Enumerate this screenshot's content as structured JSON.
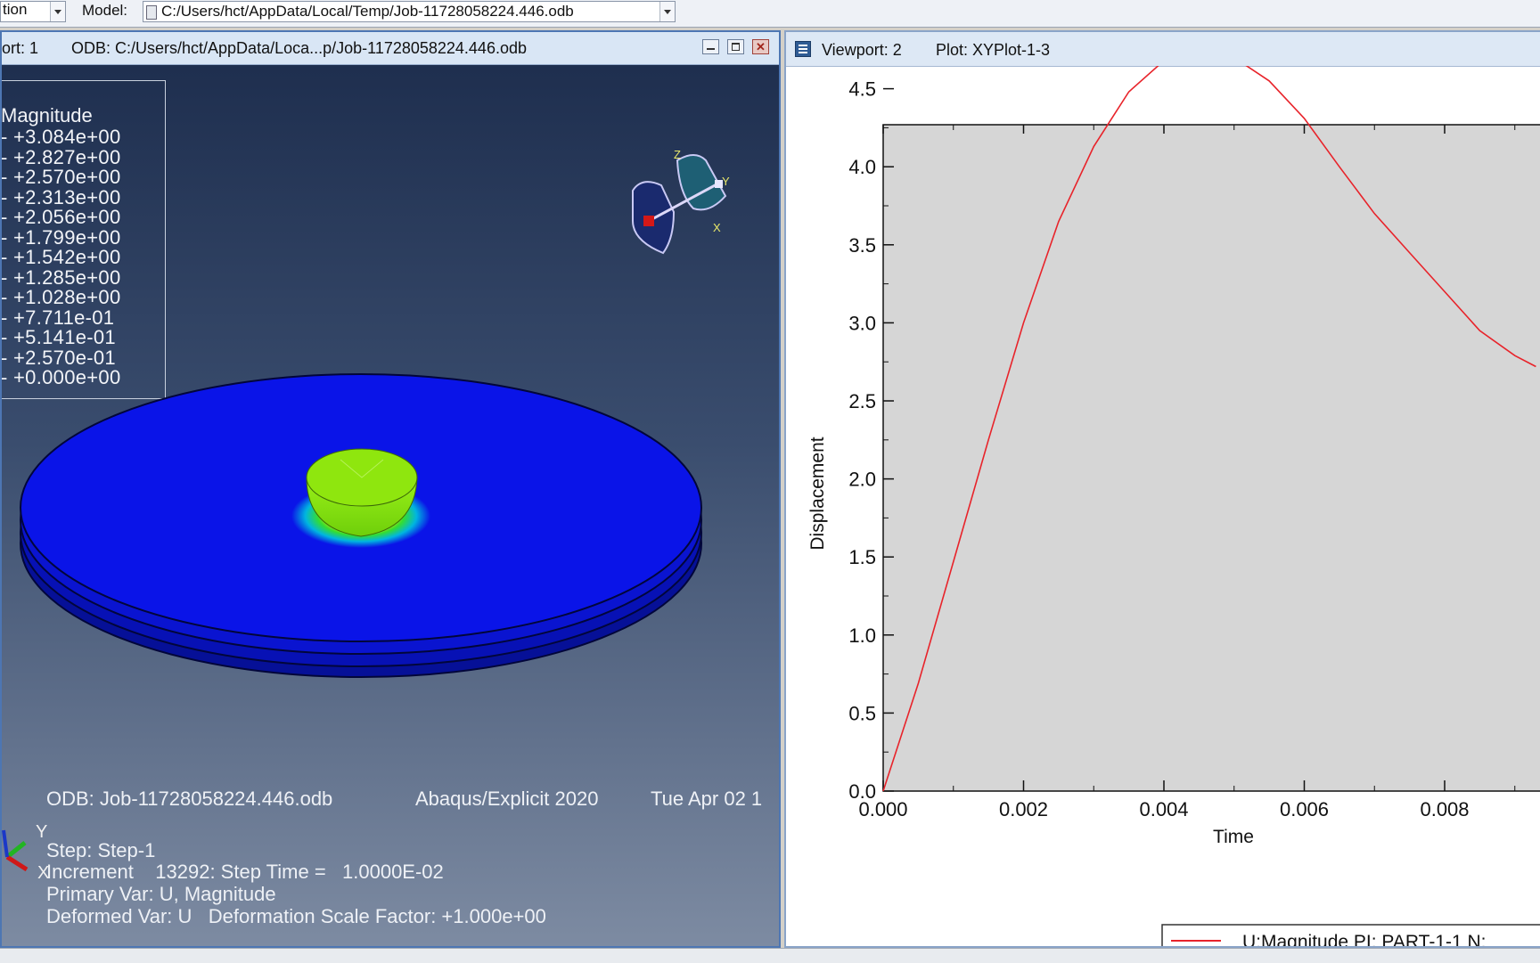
{
  "toolbar": {
    "module_value": "tion",
    "model_label": "Model:",
    "model_path": "C:/Users/hct/AppData/Local/Temp/Job-11728058224.446.odb"
  },
  "viewport1": {
    "title": "ort: 1",
    "odb_path": "ODB: C:/Users/hct/AppData/Loca...p/Job-11728058224.446.odb",
    "legend_title": "Magnitude",
    "legend_values": [
      "+3.084e+00",
      "+2.827e+00",
      "+2.570e+00",
      "+2.313e+00",
      "+2.056e+00",
      "+1.799e+00",
      "+1.542e+00",
      "+1.285e+00",
      "+1.028e+00",
      "+7.711e-01",
      "+5.141e-01",
      "+2.570e-01",
      "+0.000e+00"
    ],
    "triad": {
      "z": "Z",
      "y": "Y",
      "x": "X"
    },
    "info": {
      "odb": "ODB: Job-11728058224.446.odb",
      "solver": "Abaqus/Explicit 2020",
      "date": "Tue Apr 02 1",
      "step": "Step: Step-1",
      "increment": "Increment    13292: Step Time =   1.0000E-02",
      "primary": "Primary Var: U, Magnitude",
      "deformed": "Deformed Var: U   Deformation Scale Factor: +1.000e+00"
    },
    "axes_labels": {
      "y": "Y",
      "x": "X"
    },
    "colors": {
      "plate": "#0a14e8",
      "indenter": "#8fe60e",
      "hot": "#e8230f"
    }
  },
  "viewport2": {
    "title": "Viewport: 2",
    "plot_name": "Plot: XYPlot-1-3",
    "legend_label": "U:Magnitude PI: PART-1-1 N:"
  },
  "chart_data": {
    "type": "line",
    "xlabel": "Time",
    "ylabel": "Displacement",
    "xlim": [
      0,
      0.0093
    ],
    "ylim": [
      0,
      4.75
    ],
    "x_ticks": [
      "0.000",
      "0.002",
      "0.004",
      "0.006",
      "0.008"
    ],
    "y_ticks": [
      "0.0",
      "0.5",
      "1.0",
      "1.5",
      "2.0",
      "2.5",
      "3.0",
      "3.5",
      "4.0",
      "4.5"
    ],
    "series": [
      {
        "name": "U:Magnitude PI: PART-1-1 N:",
        "color": "#e8232a",
        "x": [
          0,
          0.0005,
          0.001,
          0.0015,
          0.002,
          0.0025,
          0.003,
          0.0035,
          0.004,
          0.0045,
          0.005,
          0.0055,
          0.006,
          0.0065,
          0.007,
          0.0075,
          0.008,
          0.0085,
          0.009,
          0.0093
        ],
        "y": [
          0,
          0.69,
          1.47,
          2.25,
          3.0,
          3.65,
          4.13,
          4.48,
          4.68,
          4.75,
          4.7,
          4.55,
          4.31,
          4.0,
          3.7,
          3.45,
          3.2,
          2.95,
          2.79,
          2.72
        ]
      }
    ],
    "grid": false,
    "legend_position": "bottom"
  }
}
